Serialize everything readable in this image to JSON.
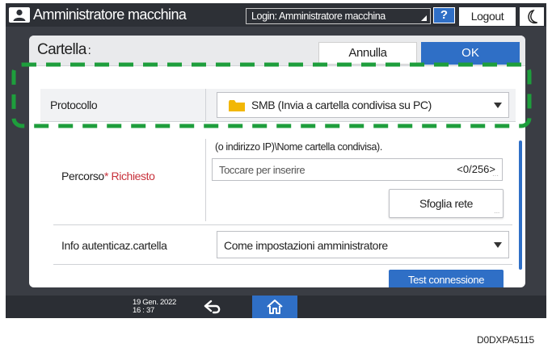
{
  "titlebar": {
    "app_title": "Amministratore macchina",
    "login_label": "Login: Amministratore macchina",
    "help_label": "?",
    "logout_label": "Logout"
  },
  "dialog": {
    "title": "Cartella",
    "title_colon": ":",
    "cancel_label": "Annulla",
    "ok_label": "OK"
  },
  "protocol": {
    "label": "Protocollo",
    "value": "SMB (Invia a cartella condivisa su PC)"
  },
  "path": {
    "hint": "(o indirizzo IP)\\Nome cartella condivisa).",
    "label": "Percorso",
    "required_label": "* Richiesto",
    "placeholder": "Toccare per inserire",
    "counter": "<0/256>",
    "browse_label": "Sfoglia rete"
  },
  "auth": {
    "label": "Info autenticaz.cartella",
    "value": "Come impostazioni amministratore"
  },
  "test_label": "Test connessione",
  "bottombar": {
    "date": "19 Gen. 2022",
    "time": "16 : 37"
  },
  "caption": "D0DXPA5115",
  "colors": {
    "accent_blue": "#2f6fc6",
    "highlight_green": "#1e9e3c",
    "required_red": "#c8313b",
    "folder_yellow": "#f2b705"
  },
  "icons": [
    "user-icon",
    "help-icon",
    "moon-icon",
    "folder-icon",
    "dropdown-arrow-icon",
    "back-icon",
    "home-icon"
  ]
}
